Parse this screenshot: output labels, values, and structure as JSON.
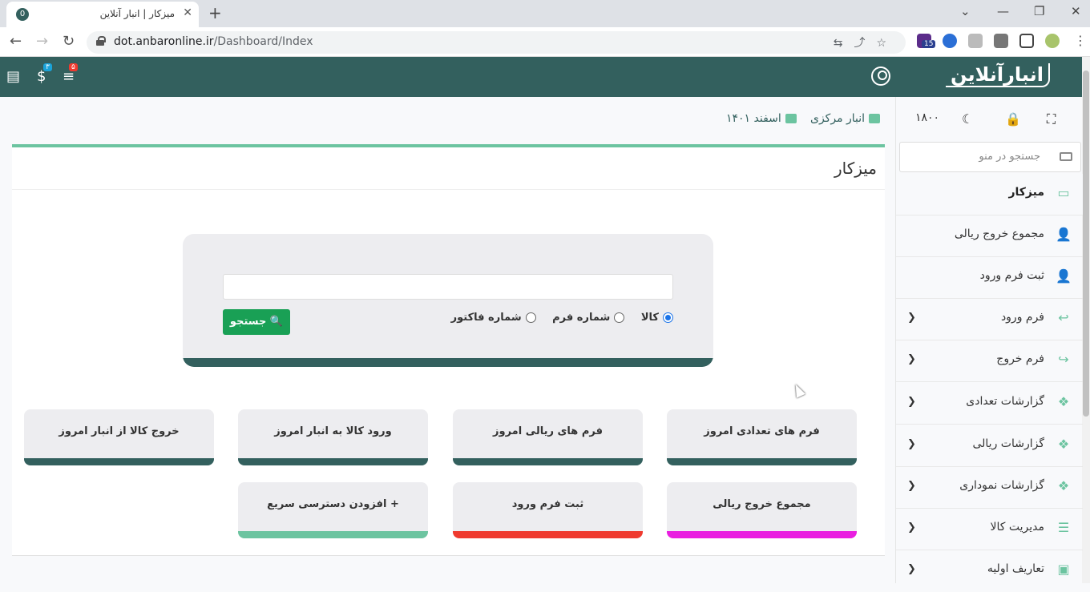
{
  "browser": {
    "tab_title": "میزکار | انبار آنلاین",
    "tab_favicon": "0",
    "new_tab": "+",
    "url_domain": "dot.anbaronline.ir",
    "url_path": "/Dashboard/Index",
    "extension_badge": "15"
  },
  "header": {
    "logo_text": "انبارآنلاین",
    "badge_money": "۳",
    "badge_list": "۵"
  },
  "sidebar": {
    "tool_value": "۱۸۰۰",
    "search_placeholder": "جستجو در منو",
    "items": [
      {
        "label": "میزکار",
        "icon": "desktop-icon"
      },
      {
        "label": "مجموع خروج ریالی",
        "icon": "user-plus-icon"
      },
      {
        "label": "ثبت فرم ورود",
        "icon": "user-plus-icon"
      },
      {
        "label": "فرم ورود",
        "icon": "reply-icon"
      },
      {
        "label": "فرم خروج",
        "icon": "share-icon"
      },
      {
        "label": "گزارشات تعدادی",
        "icon": "cubes-icon"
      },
      {
        "label": "گزارشات ریالی",
        "icon": "cubes-icon"
      },
      {
        "label": "گزارشات نموداری",
        "icon": "cubes-icon"
      },
      {
        "label": "مدیریت کالا",
        "icon": "list-icon"
      },
      {
        "label": "تعاریف اولیه",
        "icon": "archive-icon"
      }
    ]
  },
  "breadcrumb": {
    "warehouse": "انبار مرکزی",
    "date": "اسفند ۱۴۰۱"
  },
  "page": {
    "title": "میزکار",
    "search_button": "جستجو",
    "radio_options": [
      "کالا",
      "شماره فرم",
      "شماره فاکتور"
    ],
    "radio_selected": "کالا"
  },
  "tiles": [
    {
      "label": "فرم های تعدادی امروز",
      "color": "#33605e"
    },
    {
      "label": "فرم های ریالی امروز",
      "color": "#33605e"
    },
    {
      "label": "ورود کالا به انبار امروز",
      "color": "#33605e"
    },
    {
      "label": "خروج کالا از انبار امروز",
      "color": "#33605e"
    },
    {
      "label": "مجموع خروج ریالی",
      "color": "#e91ee0"
    },
    {
      "label": "ثبت فرم ورود",
      "color": "#ef3a2f"
    },
    {
      "label": "+ افزودن دسترسی سریع",
      "color": "#6cc4a0"
    }
  ],
  "colors": {
    "header": "#33605e",
    "accent": "#6cc4a0",
    "search_button": "#19a055"
  }
}
